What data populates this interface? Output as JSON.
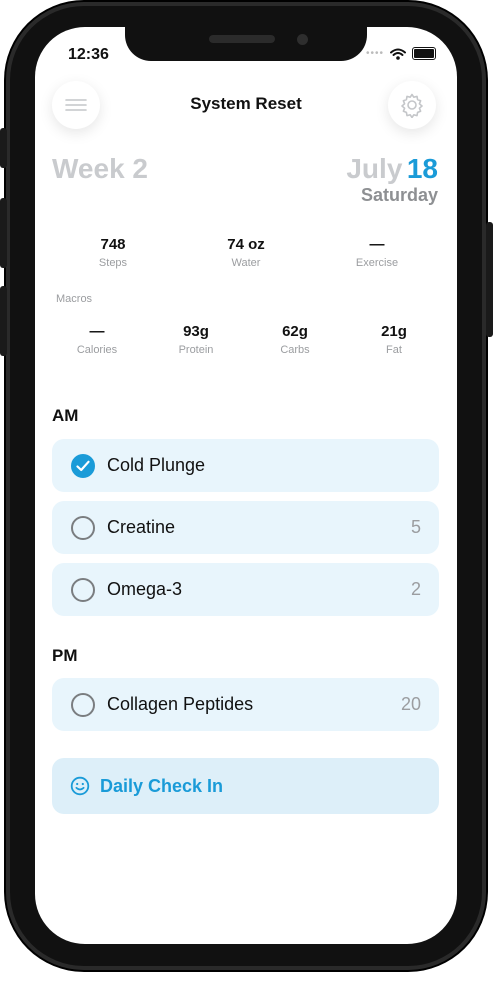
{
  "status_bar": {
    "time": "12:36"
  },
  "header": {
    "title": "System Reset"
  },
  "week_label": "Week 2",
  "date": {
    "month": "July",
    "day": "18",
    "weekday": "Saturday"
  },
  "stats": [
    {
      "value": "748",
      "label": "Steps"
    },
    {
      "value": "74 oz",
      "label": "Water"
    },
    {
      "value": "—",
      "label": "Exercise"
    }
  ],
  "macros": {
    "label": "Macros",
    "items": [
      {
        "value": "—",
        "label": "Calories"
      },
      {
        "value": "93g",
        "label": "Protein"
      },
      {
        "value": "62g",
        "label": "Carbs"
      },
      {
        "value": "21g",
        "label": "Fat"
      }
    ]
  },
  "am": {
    "label": "AM",
    "items": [
      {
        "name": "Cold Plunge",
        "count": "",
        "checked": true
      },
      {
        "name": "Creatine",
        "count": "5",
        "checked": false
      },
      {
        "name": "Omega-3",
        "count": "2",
        "checked": false
      }
    ]
  },
  "pm": {
    "label": "PM",
    "items": [
      {
        "name": "Collagen Peptides",
        "count": "20",
        "checked": false
      }
    ]
  },
  "checkin": {
    "label": "Daily Check In"
  },
  "colors": {
    "accent": "#1a9bd8",
    "card_bg": "#e8f5fc",
    "muted": "#c9cbce"
  }
}
